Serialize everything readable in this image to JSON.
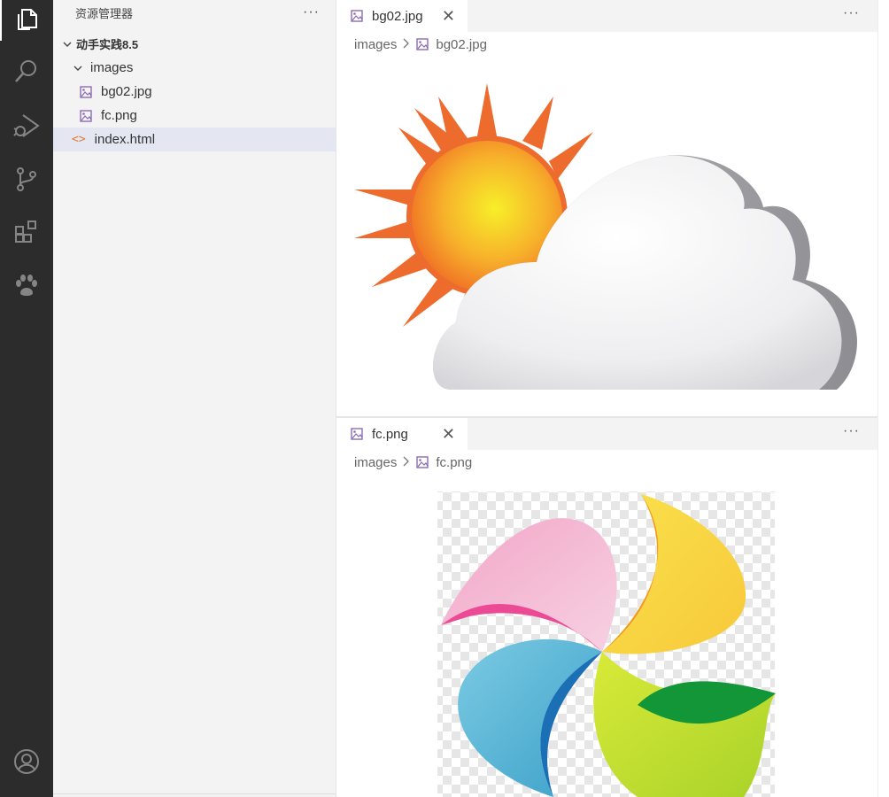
{
  "sidebar": {
    "title": "资源管理器",
    "more": "···",
    "project": "动手实践8.5",
    "folder": "images",
    "files": [
      "bg02.jpg",
      "fc.png"
    ],
    "root_file": "index.html"
  },
  "editor_top": {
    "tab_label": "bg02.jpg",
    "close": "✕",
    "more": "···",
    "breadcrumb_folder": "images",
    "breadcrumb_file": "bg02.jpg"
  },
  "editor_bottom": {
    "tab_label": "fc.png",
    "close": "✕",
    "more": "···",
    "breadcrumb_folder": "images",
    "breadcrumb_file": "fc.png"
  },
  "icons": {
    "activity": [
      "files-icon",
      "search-icon",
      "run-debug-icon",
      "source-control-icon",
      "extensions-icon",
      "paw-icon",
      "account-icon"
    ]
  },
  "colors": {
    "activity_bg": "#2c2c2c",
    "sidebar_bg": "#f3f3f3",
    "selected_row": "#e4e6f1",
    "html_icon": "#e37933",
    "image_icon": "#8a6bb5"
  }
}
